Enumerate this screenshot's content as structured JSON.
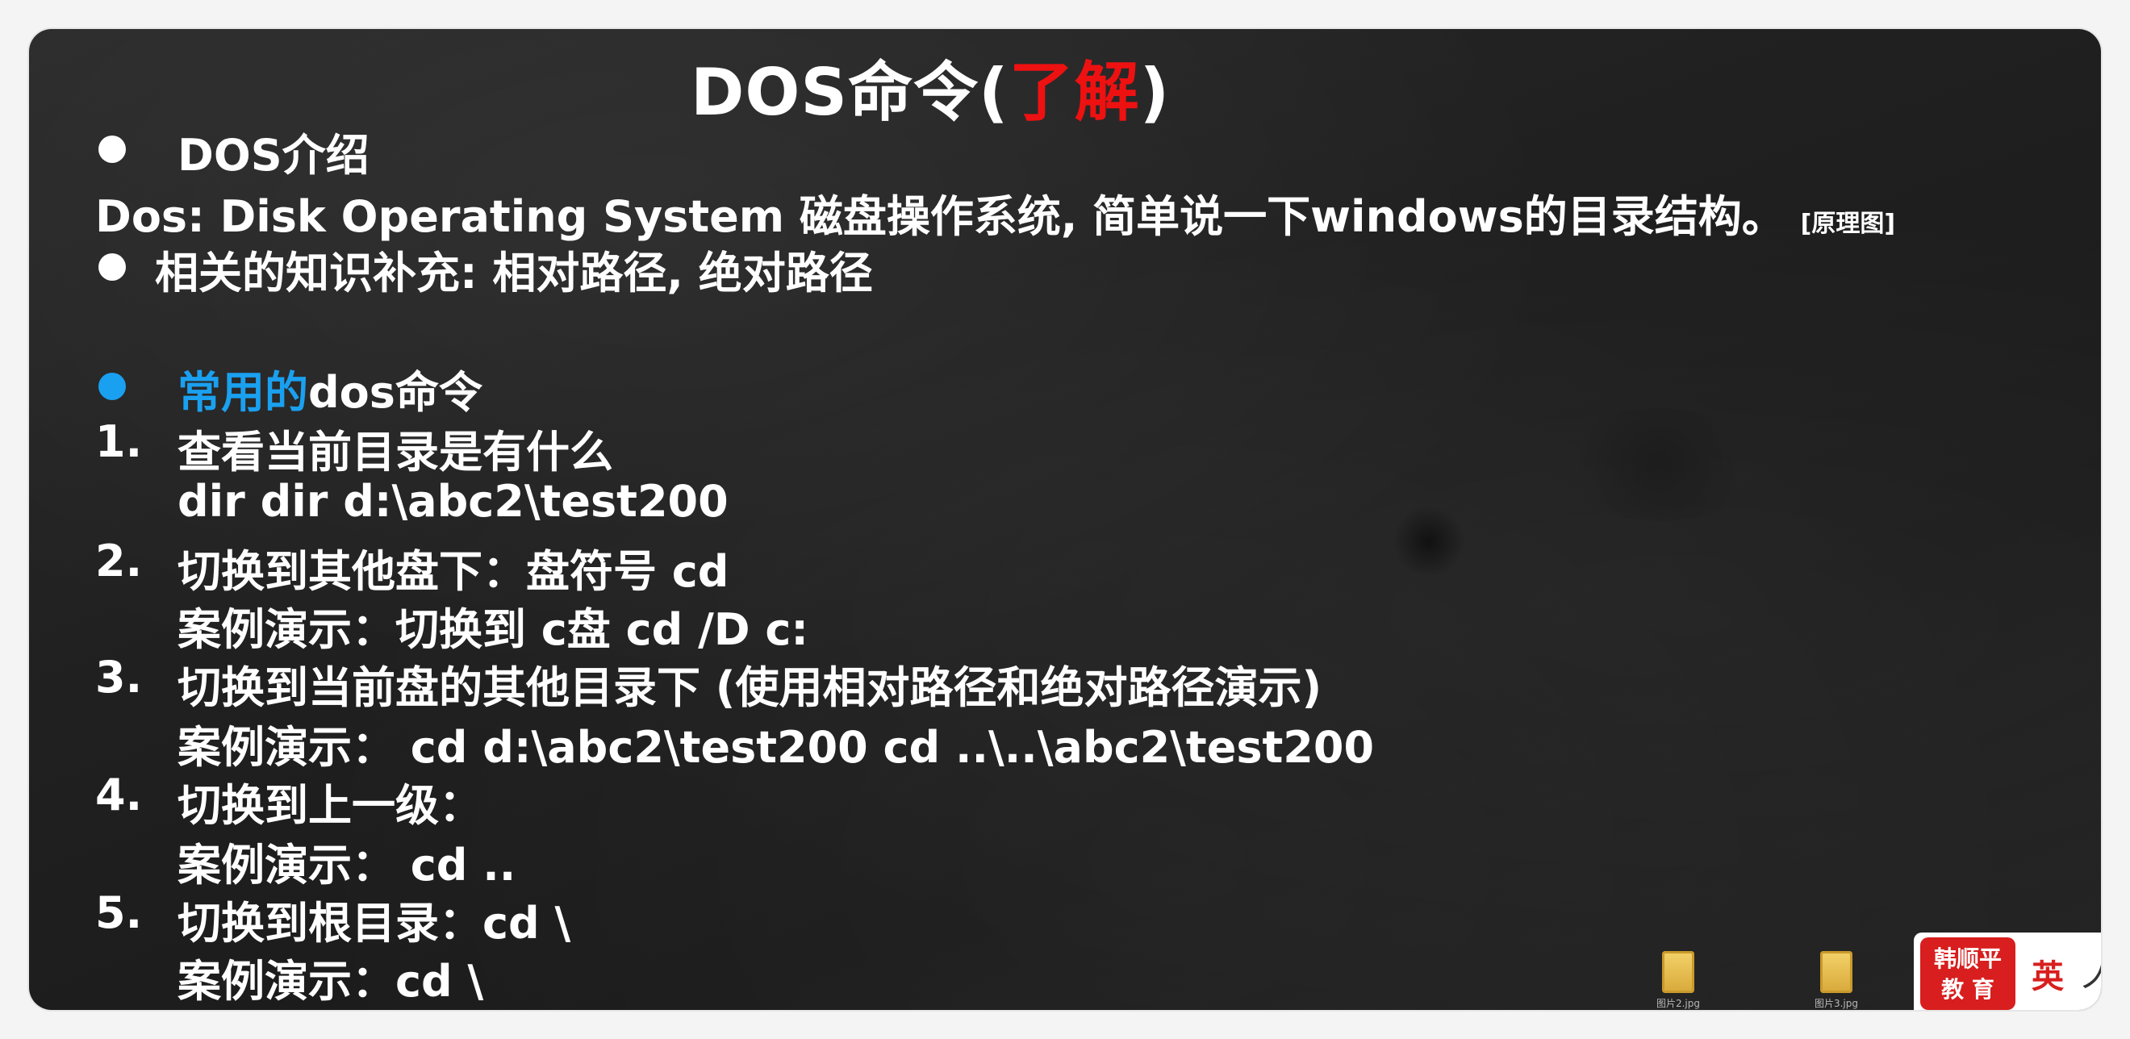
{
  "slide": {
    "title_main": "DOS命令(",
    "title_highlight": "了解",
    "title_end": ")",
    "intro_heading": "DOS介绍",
    "intro_text": "Dos:   Disk Operating System 磁盘操作系统, 简单说一下windows的目录结构。",
    "intro_note": "[原理图]",
    "knowledge_text": "相关的知识补充: 相对路径,    绝对路径",
    "common_highlight": "常用的",
    "common_rest": "dos命令",
    "items": [
      {
        "num": "1.",
        "title": "查看当前目录是有什么",
        "detail": "dir    dir d:\\abc2\\test200"
      },
      {
        "num": "2.",
        "title": "切换到其他盘下：盘符号 cd",
        "detail": "案例演示：切换到 c盘     cd /D  c:"
      },
      {
        "num": "3.",
        "title": "切换到当前盘的其他目录下 (使用相对路径和绝对路径演示)",
        "detail": "案例演示：  cd  d:\\abc2\\test200  cd ..\\..\\abc2\\test200"
      },
      {
        "num": "4.",
        "title": "切换到上一级：",
        "detail": "案例演示：  cd .."
      },
      {
        "num": "5.",
        "title": "切换到根目录：cd \\",
        "detail": "案例演示：cd \\"
      }
    ]
  },
  "overlay": {
    "desktop_icons": [
      {
        "label": "图片2.jpg"
      },
      {
        "label": "图片3.jpg"
      }
    ],
    "logo_line1": "韩顺平",
    "logo_line2": "教 育",
    "logo_side": "英",
    "logo_side2": "ノ"
  },
  "colors": {
    "highlight_red": "#ee1111",
    "accent_blue": "#1aa0f0",
    "text": "#ffffff"
  }
}
